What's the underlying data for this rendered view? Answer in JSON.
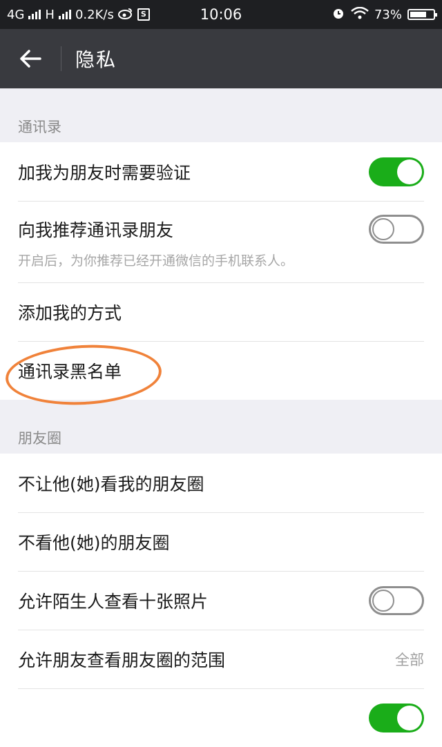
{
  "status_bar": {
    "network1": "4G",
    "network2": "H",
    "speed": "0.2K/s",
    "time": "10:06",
    "battery": "73%",
    "battery_level": 0.73,
    "icons": [
      "signal-icon",
      "weibo-icon",
      "s-box-icon",
      "alarm-icon",
      "wifi-icon",
      "battery-icon"
    ]
  },
  "header": {
    "title": "隐私"
  },
  "sections": {
    "contacts": {
      "title": "通讯录",
      "verify": {
        "label": "加我为朋友时需要验证",
        "on": true
      },
      "recommend": {
        "label": "向我推荐通讯录朋友",
        "on": false,
        "subtext": "开启后，为你推荐已经开通微信的手机联系人。"
      },
      "add_methods": {
        "label": "添加我的方式"
      },
      "blacklist": {
        "label": "通讯录黑名单"
      }
    },
    "moments": {
      "title": "朋友圈",
      "hide_mine": {
        "label": "不让他(她)看我的朋友圈"
      },
      "hide_theirs": {
        "label": "不看他(她)的朋友圈"
      },
      "strangers": {
        "label": "允许陌生人查看十张照片",
        "on": false
      },
      "range": {
        "label": "允许朋友查看朋友圈的范围",
        "value": "全部"
      }
    }
  },
  "colors": {
    "toggle_on": "#1aad19",
    "highlight": "#f0823a",
    "nav_bg": "#393a3f"
  }
}
